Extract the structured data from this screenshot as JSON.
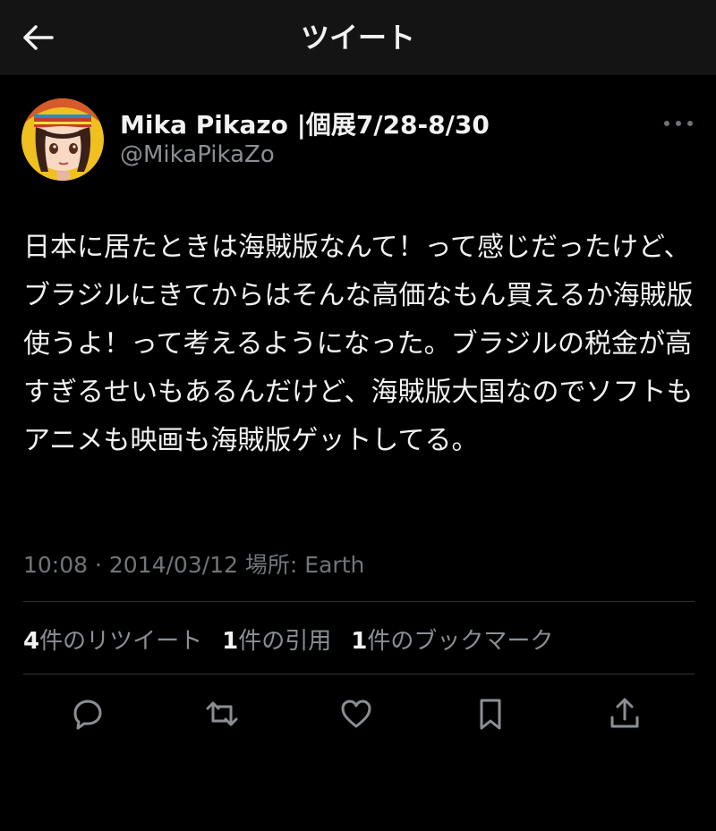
{
  "header": {
    "title": "ツイート",
    "back_icon": "back-arrow-icon"
  },
  "author": {
    "name": "Mika Pikazo |個展7/28-8/30",
    "handle": "@MikaPikaZo"
  },
  "tweet": {
    "text": "日本に居たときは海賊版なんて！って感じだったけど、ブラジルにきてからはそんな高価なもん買えるか海賊版使うよ！って考えるようになった。ブラジルの税金が高すぎるせいもあるんだけど、海賊版大国なのでソフトもアニメも映画も海賊版ゲットしてる。",
    "meta": "10:08 · 2014/03/12 場所: Earth"
  },
  "stats": {
    "retweets_count": "4",
    "retweets_label": "件のリツイート",
    "quotes_count": "1",
    "quotes_label": "件の引用",
    "bookmarks_count": "1",
    "bookmarks_label": "件のブックマーク"
  },
  "actions": {
    "icons": [
      "reply-icon",
      "retweet-icon",
      "like-icon",
      "bookmark-icon",
      "share-icon"
    ]
  },
  "colors": {
    "background": "#000000",
    "header": "#141414",
    "text": "#f2f2f2",
    "muted": "#8b8f94",
    "divider": "#2f3336"
  }
}
